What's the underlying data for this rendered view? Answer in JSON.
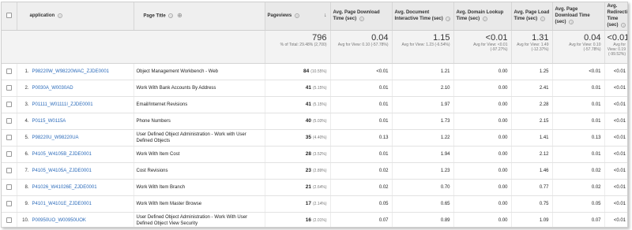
{
  "header": {
    "application": "application",
    "page_title": "Page Title",
    "pageviews": "Pageviews",
    "avg_page_download": "Avg. Page Download Time (sec)",
    "avg_doc_interactive": "Avg. Document Interactive Time (sec)",
    "avg_domain_lookup": "Avg. Domain Lookup Time (sec)",
    "avg_page_load": "Avg. Page Load Time (sec)",
    "avg_page_download2": "Avg. Page Download Time (sec)",
    "avg_redirection": "Avg. Redirection Time (sec)"
  },
  "totals": [
    {
      "value": "796",
      "sub": "% of Total: 29.48% (2,700)"
    },
    {
      "value": "0.04",
      "sub": "Avg for View: 0.10 (-57.78%)"
    },
    {
      "value": "1.15",
      "sub": "Avg for View: 1.23 (-6.54%)"
    },
    {
      "value": "<0.01",
      "sub": "Avg for View: <0.01 (-97.27%)"
    },
    {
      "value": "1.31",
      "sub": "Avg for View: 1.49 (-12.37%)"
    },
    {
      "value": "0.04",
      "sub": "Avg for View: 0.10 (-57.78%)"
    },
    {
      "value": "<0.01",
      "sub": "Avg for View: 0.19 (-99.52%)"
    }
  ],
  "rows": [
    {
      "idx": "1.",
      "app": "P98220W_W98220WAC_ZJDE0001",
      "title": "Object Management Workbench - Web",
      "pv": "84",
      "pct": "(10.55%)",
      "c1": "<0.01",
      "c2": "1.21",
      "c3": "0.00",
      "c4": "1.25",
      "c5": "<0.01",
      "c6": "<0.01"
    },
    {
      "idx": "2.",
      "app": "P0030A_W0030AD",
      "title": "Work With Bank Accounts By Address",
      "pv": "41",
      "pct": "(5.15%)",
      "c1": "0.01",
      "c2": "2.10",
      "c3": "0.00",
      "c4": "2.41",
      "c5": "0.01",
      "c6": "<0.01"
    },
    {
      "idx": "3.",
      "app": "P01111_W01111I_ZJDE0001",
      "title": "Email/Internet Revisions",
      "pv": "41",
      "pct": "(5.15%)",
      "c1": "0.01",
      "c2": "1.97",
      "c3": "0.00",
      "c4": "2.28",
      "c5": "0.01",
      "c6": "<0.01"
    },
    {
      "idx": "4.",
      "app": "P0115_W0115A",
      "title": "Phone Numbers",
      "pv": "40",
      "pct": "(5.03%)",
      "c1": "0.01",
      "c2": "1.73",
      "c3": "0.00",
      "c4": "2.15",
      "c5": "0.01",
      "c6": "<0.01"
    },
    {
      "idx": "5.",
      "app": "P98220U_W98220UA",
      "title": "User Defined Object Administration - Work with User Defined Objects",
      "pv": "35",
      "pct": "(4.40%)",
      "c1": "0.13",
      "c2": "1.22",
      "c3": "0.00",
      "c4": "1.41",
      "c5": "0.13",
      "c6": "<0.01"
    },
    {
      "idx": "6.",
      "app": "P4105_W4105B_ZJDE0001",
      "title": "Work With Item Cost",
      "pv": "28",
      "pct": "(3.52%)",
      "c1": "0.01",
      "c2": "1.94",
      "c3": "0.00",
      "c4": "2.12",
      "c5": "0.01",
      "c6": "<0.01"
    },
    {
      "idx": "7.",
      "app": "P4105_W4105A_ZJDE0001",
      "title": "Cost Revisions",
      "pv": "23",
      "pct": "(2.89%)",
      "c1": "0.02",
      "c2": "1.23",
      "c3": "0.00",
      "c4": "1.46",
      "c5": "0.02",
      "c6": "<0.01"
    },
    {
      "idx": "8.",
      "app": "P41026_W41026E_ZJDE0001",
      "title": "Work With Item Branch",
      "pv": "21",
      "pct": "(2.64%)",
      "c1": "0.02",
      "c2": "0.70",
      "c3": "0.00",
      "c4": "0.77",
      "c5": "0.02",
      "c6": "<0.01"
    },
    {
      "idx": "9.",
      "app": "P4101_W4101E_ZJDE0001",
      "title": "Work With Item Master Browse",
      "pv": "17",
      "pct": "(2.14%)",
      "c1": "0.05",
      "c2": "0.65",
      "c3": "0.00",
      "c4": "0.75",
      "c5": "0.05",
      "c6": "<0.01"
    },
    {
      "idx": "10.",
      "app": "P00950UO_W00950UOK",
      "title": "User Defined Object Administration - Work With User Defined Object View Security",
      "pv": "16",
      "pct": "(2.01%)",
      "c1": "0.07",
      "c2": "0.89",
      "c3": "0.00",
      "c4": "1.09",
      "c5": "0.07",
      "c6": "<0.01"
    }
  ]
}
